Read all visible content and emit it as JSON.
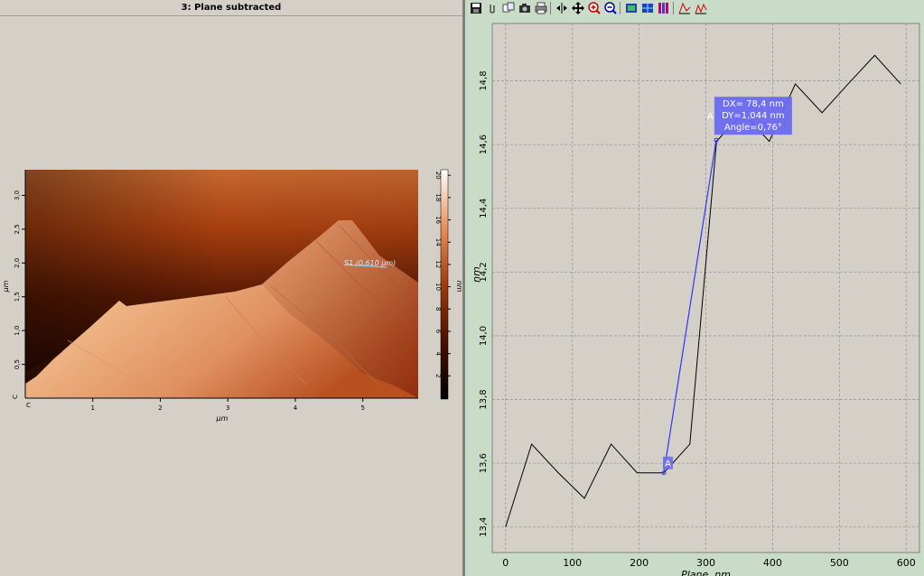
{
  "left_panel": {
    "title": "3: Plane subtracted",
    "image": {
      "x_axis_label": "µm",
      "y_axis_label": "µm",
      "x_ticks": [
        "1",
        "2",
        "3",
        "4",
        "5"
      ],
      "y_ticks": [
        "0,5",
        "1,0",
        "1,5",
        "2,0",
        "2,5",
        "3,0"
      ],
      "y_zero": "C",
      "x_zero": "C",
      "section_label": "S1 (0,610 µm)"
    },
    "colorbar": {
      "label": "nm",
      "ticks": [
        "2",
        "4",
        "6",
        "8",
        "10",
        "12",
        "14",
        "16",
        "18",
        "20"
      ]
    }
  },
  "toolbar": {
    "buttons": [
      "save-icon",
      "clip-icon",
      "copy-values-icon",
      "camera-icon",
      "print-icon",
      "cursor-arrows-icon",
      "pan-icon",
      "zoom-in-icon",
      "zoom-out-icon",
      "fit-icon",
      "grid-icon",
      "color-bars-icon",
      "measure-peak-icon",
      "measure-steps-icon"
    ]
  },
  "chart_data": {
    "type": "line",
    "xlabel": "Plane, nm",
    "ylabel": "nm",
    "xlim": [
      -20,
      620
    ],
    "ylim": [
      13.32,
      14.98
    ],
    "x_ticks": [
      0,
      100,
      200,
      300,
      400,
      500,
      600
    ],
    "x_tick_labels": [
      "0",
      "100",
      "200",
      "300",
      "400",
      "500",
      "600"
    ],
    "y_ticks": [
      13.4,
      13.6,
      13.8,
      14.0,
      14.2,
      14.4,
      14.6,
      14.8
    ],
    "y_tick_labels": [
      "13,4",
      "13,6",
      "13,8",
      "14,0",
      "14,2",
      "14,4",
      "14,6",
      "14,8"
    ],
    "grid": true,
    "series": [
      {
        "color": "#000000",
        "x": [
          0,
          39,
          79,
          118,
          158,
          197,
          237,
          276,
          316,
          355,
          395,
          434,
          474,
          513,
          553,
          592
        ],
        "y": [
          13.4,
          13.66,
          13.57,
          13.49,
          13.66,
          13.57,
          13.57,
          13.66,
          14.61,
          14.7,
          14.61,
          14.79,
          14.7,
          14.79,
          14.88,
          14.79
        ]
      }
    ],
    "measurement": {
      "color": "#3333ff",
      "start": [
        237,
        13.57
      ],
      "end": [
        315.4,
        14.614
      ],
      "marker_label": "A",
      "box_prefix": "A",
      "lines": [
        "DX= 78,4 nm",
        "DY=1,044 nm",
        "Angle=0,76°"
      ]
    }
  }
}
